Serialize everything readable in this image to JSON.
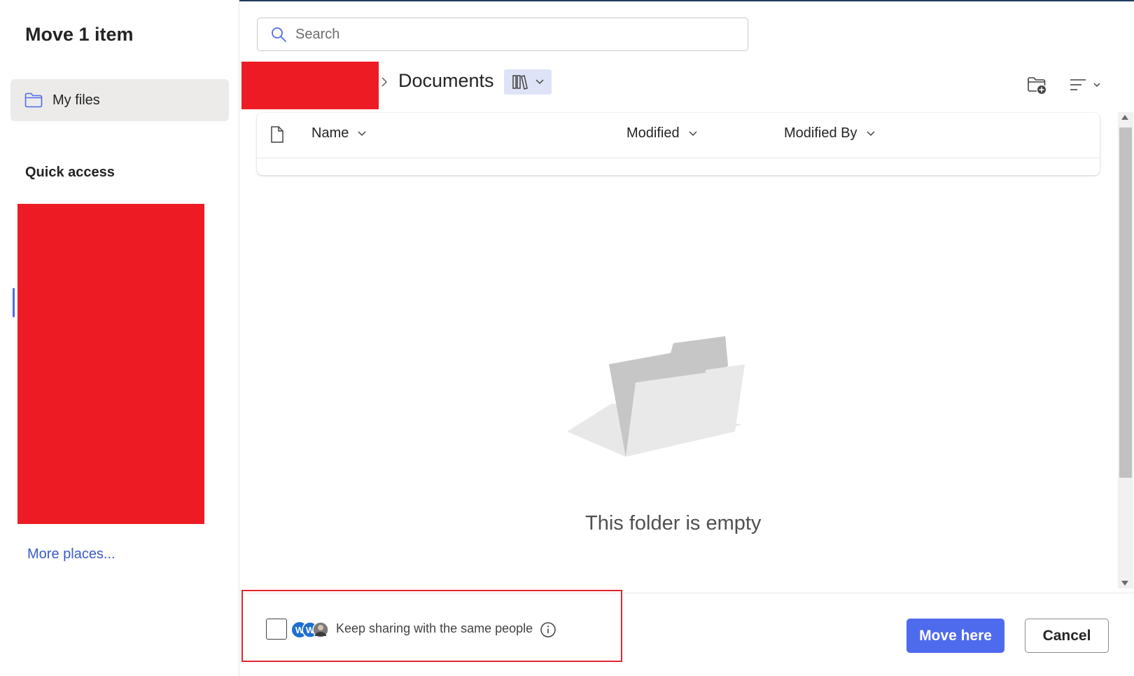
{
  "dialog": {
    "title": "Move 1 item"
  },
  "sidebar": {
    "my_files_label": "My files",
    "quick_access_label": "Quick access",
    "more_places_label": "More places..."
  },
  "search": {
    "placeholder": "Search",
    "value": ""
  },
  "breadcrumb": {
    "current": "Documents"
  },
  "list": {
    "columns": [
      {
        "label": "Name"
      },
      {
        "label": "Modified"
      },
      {
        "label": "Modified By"
      }
    ],
    "empty_message": "This folder is empty"
  },
  "footer": {
    "keep_sharing_label": "Keep sharing with the same people",
    "keep_sharing_checked": false,
    "move_label": "Move here",
    "cancel_label": "Cancel"
  },
  "colors": {
    "accent": "#4f6bed",
    "redaction": "#ed1c24",
    "highlight_border": "#e3262f",
    "link": "#3b5bcc"
  },
  "icons": [
    "folder-icon",
    "search-icon",
    "chevron-right-icon",
    "library-icon",
    "chevron-down-icon",
    "new-folder-icon",
    "view-options-icon",
    "file-icon",
    "empty-folder-illustration",
    "info-icon"
  ]
}
